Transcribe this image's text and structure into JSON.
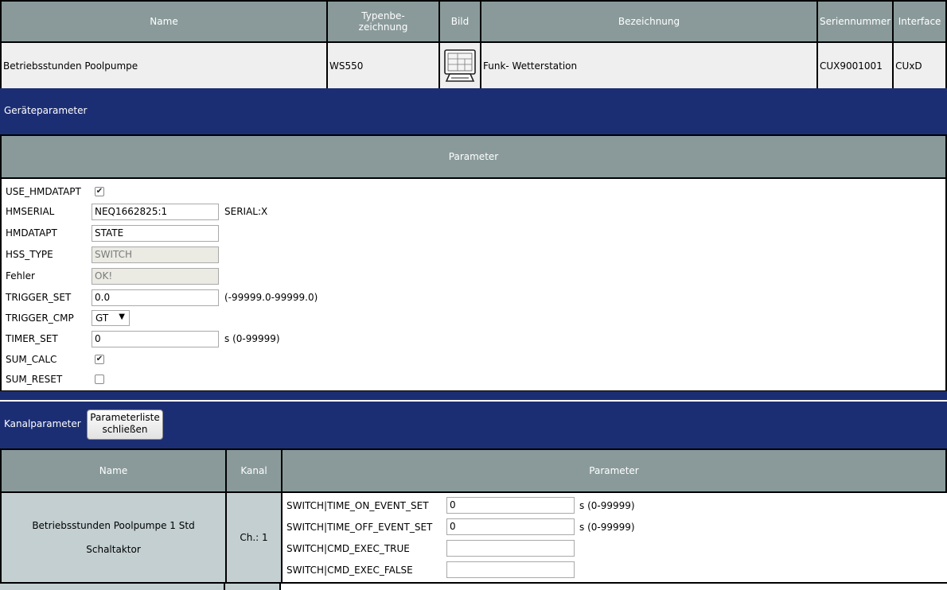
{
  "device_table": {
    "headers": {
      "name": "Name",
      "type_line1": "Typenbe-",
      "type_line2": "zeichnung",
      "picture": "Bild",
      "description": "Bezeichnung",
      "serial": "Seriennummer",
      "interface": "Interface"
    },
    "row": {
      "name": "Betriebsstunden Poolpumpe",
      "type": "WS550",
      "picture_icon": "weather-station-icon",
      "description": "Funk- Wetterstation",
      "serial": "CUX9001001",
      "interface": "CUxD"
    }
  },
  "device_params": {
    "band_label": "Geräteparameter",
    "header": "Parameter",
    "rows": [
      {
        "label": "USE_HMDATAPT",
        "checked": true
      },
      {
        "label": "HMSERIAL",
        "value": "NEQ1662825:1",
        "hint": "SERIAL:X"
      },
      {
        "label": "HMDATAPT",
        "value": "STATE"
      },
      {
        "label": "HSS_TYPE",
        "value": "SWITCH"
      },
      {
        "label": "Fehler",
        "value": "OK!"
      },
      {
        "label": "TRIGGER_SET",
        "value": "0.0",
        "hint": "(-99999.0-99999.0)"
      },
      {
        "label": "TRIGGER_CMP",
        "value": "GT"
      },
      {
        "label": "TIMER_SET",
        "value": "0",
        "hint": "s (0-99999)"
      },
      {
        "label": "SUM_CALC",
        "checked": true
      },
      {
        "label": "SUM_RESET",
        "checked": false
      }
    ],
    "check_glyph": "✔"
  },
  "channel_params": {
    "band_label": "Kanalparameter",
    "close_button_line1": "Parameterliste",
    "close_button_line2": "schließen",
    "headers": {
      "name": "Name",
      "channel": "Kanal",
      "parameter": "Parameter"
    },
    "channel": {
      "name_line1": "Betriebsstunden Poolpumpe 1 Std",
      "name_line2": "Schaltaktor",
      "number": "Ch.: 1",
      "params": [
        {
          "label": "SWITCH|TIME_ON_EVENT_SET",
          "value": "0",
          "hint": "s (0-99999)"
        },
        {
          "label": "SWITCH|TIME_OFF_EVENT_SET",
          "value": "0",
          "hint": "s (0-99999)"
        },
        {
          "label": "SWITCH|CMD_EXEC_TRUE",
          "value": ""
        },
        {
          "label": "SWITCH|CMD_EXEC_FALSE",
          "value": ""
        }
      ]
    }
  },
  "colors": {
    "header_gray": "#8a9a9a",
    "band_blue": "#1c2e73",
    "row_light": "#efefef",
    "channel_cell": "#c3cfd1"
  }
}
